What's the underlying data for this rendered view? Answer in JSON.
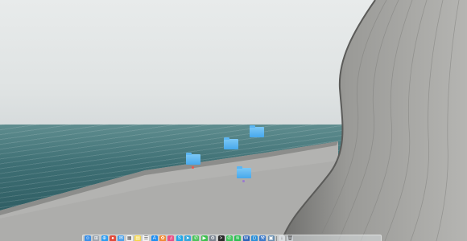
{
  "desktop": {
    "icons": [
      {
        "label": "",
        "tag_color": "#e8574c"
      },
      {
        "label": "",
        "tag_color": ""
      },
      {
        "label": "",
        "tag_color": ""
      },
      {
        "label": "",
        "tag_color": "#9b7ad0"
      }
    ]
  },
  "dock": {
    "apps": [
      {
        "name": "finder-icon",
        "color": "#3b8fe6",
        "glyph": "☺"
      },
      {
        "name": "launchpad-icon",
        "color": "#9aa3ad",
        "glyph": "⊞"
      },
      {
        "name": "safari-icon",
        "color": "#2c9cf0",
        "glyph": "⊕"
      },
      {
        "name": "chrome-icon",
        "color": "#e04b3c",
        "glyph": "●"
      },
      {
        "name": "mail-icon",
        "color": "#4a9fe8",
        "glyph": "✉"
      },
      {
        "name": "calendar-icon",
        "color": "#f4f4f4",
        "glyph": "▦"
      },
      {
        "name": "notes-icon",
        "color": "#f5d547",
        "glyph": "▤"
      },
      {
        "name": "reminders-icon",
        "color": "#f2f2f2",
        "glyph": "☰"
      },
      {
        "name": "app-store-icon",
        "color": "#1f8ef1",
        "glyph": "A"
      },
      {
        "name": "photos-icon",
        "color": "#f08a34",
        "glyph": "✿"
      },
      {
        "name": "itunes-icon",
        "color": "#e94f86",
        "glyph": "♫"
      },
      {
        "name": "skype-icon",
        "color": "#1ea7e8",
        "glyph": "S"
      },
      {
        "name": "telegram-icon",
        "color": "#33a7dc",
        "glyph": "➤"
      },
      {
        "name": "messages-icon",
        "color": "#4cc35c",
        "glyph": "✆"
      },
      {
        "name": "facetime-icon",
        "color": "#3fbf4f",
        "glyph": "▶"
      },
      {
        "name": "system-preferences-icon",
        "color": "#7b8591",
        "glyph": "⚙"
      },
      {
        "name": "terminal-icon",
        "color": "#2b2b2b",
        "glyph": ">"
      },
      {
        "name": "whatsapp-icon",
        "color": "#3ec45a",
        "glyph": "✆"
      },
      {
        "name": "spotify-icon",
        "color": "#2fbf55",
        "glyph": "≋"
      },
      {
        "name": "word-icon",
        "color": "#2b63b8",
        "glyph": "W"
      },
      {
        "name": "vscode-icon",
        "color": "#2b8fd8",
        "glyph": "⟨⟩"
      },
      {
        "name": "xcode-icon",
        "color": "#3a78c8",
        "glyph": "⚒"
      },
      {
        "name": "preview-icon",
        "color": "#6a8fb0",
        "glyph": "▣"
      },
      {
        "name": "downloads-icon",
        "color": "#d9dde0",
        "glyph": "↓"
      },
      {
        "name": "trash-icon",
        "color": "#c9ced2",
        "glyph": "🗑"
      }
    ]
  }
}
